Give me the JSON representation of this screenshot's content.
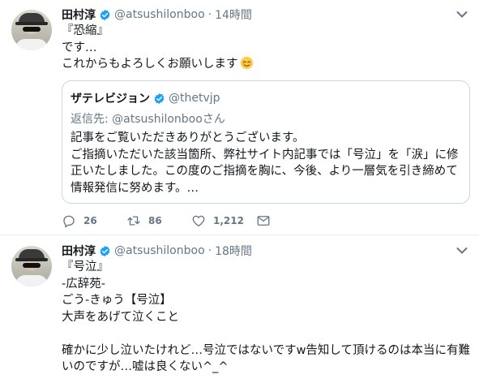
{
  "tweets": [
    {
      "author_name": "田村淳",
      "handle": "@atsushilonboo",
      "separator": "·",
      "time": "14時間",
      "text": "『恐縮』\nです…\nこれからもよろしくお願いします",
      "emoji_icon": "relieved-face-emoji",
      "quoted": {
        "author_name": "ザテレビジョン",
        "handle": "@thetvjp",
        "reply_prefix": "返信先:",
        "reply_to": "@atsushilonbooさん",
        "text": "記事をご覧いただきありがとうございます。\nご指摘いただいた該当箇所、弊社サイト内記事では「号泣」を「涙」に修正いたしました。この度のご指摘を胸に、今後、より一層気を引き締めて情報発信に努めます。…"
      },
      "actions": {
        "replies": "26",
        "retweets": "86",
        "likes": "1,212"
      }
    },
    {
      "author_name": "田村淳",
      "handle": "@atsushilonboo",
      "separator": "·",
      "time": "18時間",
      "text": "『号泣』\n-広辞苑-\nごう-きゅう【号泣】\n大声をあげて泣くこと\n\n確かに少し泣いたけれど…号泣ではないですw告知して頂けるのは本当に有難いのですが…嘘は良くない^_^"
    }
  ],
  "colors": {
    "verified": "#1da1f2",
    "secondary_text": "#657786",
    "icon": "#657786"
  }
}
